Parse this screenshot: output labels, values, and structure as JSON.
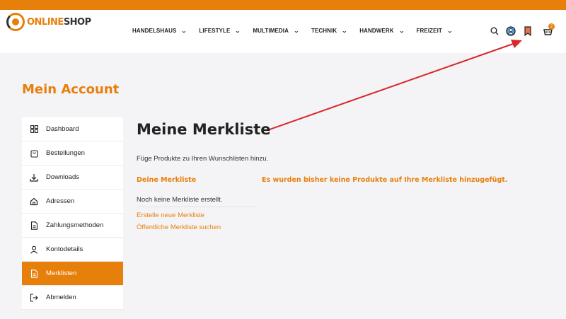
{
  "brand": {
    "logo_part1": "ONLINE",
    "logo_part2": "SHOP"
  },
  "nav": [
    {
      "label": "HANDELSHAUS"
    },
    {
      "label": "LIFESTYLE"
    },
    {
      "label": "MULTIMEDIA"
    },
    {
      "label": "TECHNIK"
    },
    {
      "label": "HANDWERK"
    },
    {
      "label": "FREIZEIT"
    }
  ],
  "header_icons": [
    "search-icon",
    "account-icon",
    "bookmark-icon",
    "cart-icon"
  ],
  "cart": {
    "count": "2"
  },
  "account": {
    "title": "Mein Account"
  },
  "sidebar": {
    "items": [
      {
        "label": "Dashboard",
        "icon": "grid-icon"
      },
      {
        "label": "Bestellungen",
        "icon": "bag-icon"
      },
      {
        "label": "Downloads",
        "icon": "download-icon"
      },
      {
        "label": "Adressen",
        "icon": "home-icon"
      },
      {
        "label": "Zahlungsmethoden",
        "icon": "document-icon"
      },
      {
        "label": "Kontodetails",
        "icon": "user-icon"
      },
      {
        "label": "Merklisten",
        "icon": "document-icon",
        "active": true
      },
      {
        "label": "Abmelden",
        "icon": "logout-icon"
      }
    ]
  },
  "main": {
    "title": "Meine Merkliste",
    "intro": "Füge Produkte zu Ihren Wunschlisten hinzu.",
    "wishlist_heading": "Deine Merkliste",
    "empty_message": "Es wurden bisher keine Produkte auf Ihre Merkliste hinzugefügt.",
    "no_list_text": "Noch keine Merkliste erstellt.",
    "create_link": "Erstelle neue Merkliste",
    "search_link": "Öffentliche Merkliste suchen"
  },
  "colors": {
    "accent": "#e77f0b",
    "annotation": "#d9262b",
    "text": "#222222",
    "background": "#f4f4f6"
  }
}
